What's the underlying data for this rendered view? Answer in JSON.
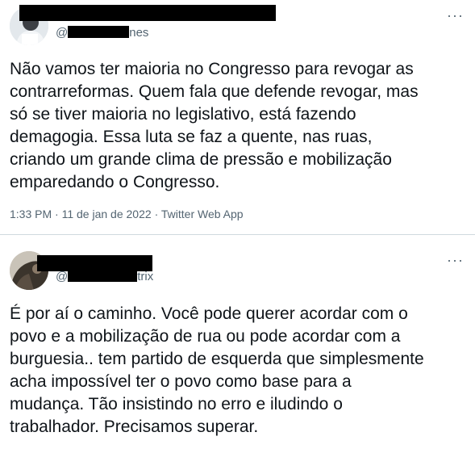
{
  "tweets": [
    {
      "handle_prefix": "@",
      "handle_suffix": "nes",
      "text": "Não vamos ter maioria no Congresso para revogar as\ncontrarreformas. Quem fala que defende revogar, mas\nsó se tiver maioria no legislativo, está fazendo\ndemagogia. Essa luta se faz a quente, nas ruas,\ncriando um grande clima de pressão e mobilização\nemparedando o Congresso.",
      "time": "1:33 PM",
      "separator": "·",
      "date": "11 de jan de 2022",
      "source": "Twitter Web App",
      "more_icon": "···"
    },
    {
      "handle_prefix": "@",
      "handle_suffix": "trix",
      "text": "É por aí o caminho. Você pode querer acordar com o\npovo e a mobilização de rua ou pode acordar com a\nburguesia.. tem partido de esquerda que simplesmente\nacha impossível ter o povo como base para a\nmudança. Tão insistindo no erro e iludindo o\ntrabalhador. Precisamos superar.",
      "more_icon": "···"
    }
  ],
  "colors": {
    "text": "#0f1419",
    "secondary": "#536471",
    "divider": "#cfd9de",
    "redaction": "#000000"
  }
}
